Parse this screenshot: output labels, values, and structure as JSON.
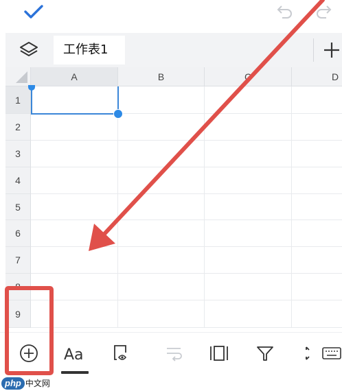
{
  "sheet": {
    "tab_label": "工作表1"
  },
  "columns": [
    "A",
    "B",
    "C",
    "D"
  ],
  "rows": [
    "1",
    "2",
    "3",
    "4",
    "5",
    "6",
    "7",
    "8",
    "9"
  ],
  "selection": {
    "cell": "A1"
  },
  "toolbar": {
    "items": [
      {
        "name": "insert",
        "icon": "plus-circle-icon"
      },
      {
        "name": "font-format",
        "icon": "font-format-icon",
        "label": "Aa",
        "active": true
      },
      {
        "name": "cell-style",
        "icon": "cell-style-icon"
      },
      {
        "name": "wrap-text",
        "icon": "wrap-text-icon",
        "disabled": true
      },
      {
        "name": "freeze",
        "icon": "freeze-panes-icon"
      },
      {
        "name": "filter",
        "icon": "filter-icon"
      },
      {
        "name": "resize",
        "icon": "resize-icon"
      },
      {
        "name": "keyboard",
        "icon": "keyboard-icon"
      }
    ]
  },
  "watermark": {
    "logo": "php",
    "text": "中文网"
  },
  "colors": {
    "accent": "#2d8ae6",
    "annotation": "#e0504a",
    "header_bg": "#f1f2f4"
  }
}
